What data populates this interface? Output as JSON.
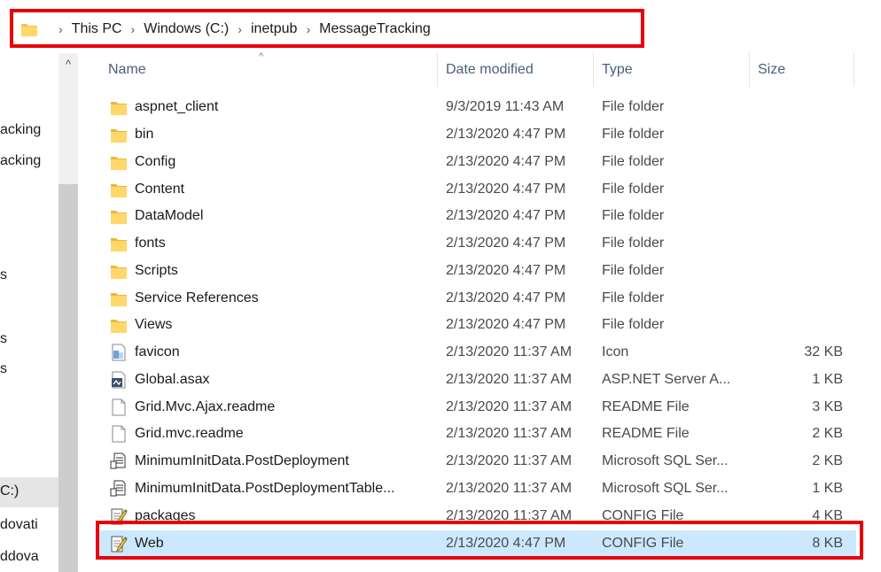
{
  "breadcrumb": {
    "items": [
      "This PC",
      "Windows (C:)",
      "inetpub",
      "MessageTracking"
    ],
    "separator": "›"
  },
  "nav": {
    "scroll_up": "^",
    "items": [
      {
        "label": "acking",
        "selected": false
      },
      {
        "label": "acking",
        "selected": false
      },
      {
        "label": "s",
        "selected": false
      },
      {
        "label": "s",
        "selected": false
      },
      {
        "label": "s",
        "selected": false
      },
      {
        "label": "C:)",
        "selected": true
      },
      {
        "label": "dovati",
        "selected": false
      },
      {
        "label": "ddova",
        "selected": false
      }
    ]
  },
  "columns": {
    "name": "Name",
    "date": "Date modified",
    "type": "Type",
    "size": "Size",
    "sort_indicator": "^"
  },
  "files": [
    {
      "name": "aspnet_client",
      "date": "9/3/2019 11:43 AM",
      "type": "File folder",
      "size": "",
      "icon": "folder-icon"
    },
    {
      "name": "bin",
      "date": "2/13/2020 4:47 PM",
      "type": "File folder",
      "size": "",
      "icon": "folder-icon"
    },
    {
      "name": "Config",
      "date": "2/13/2020 4:47 PM",
      "type": "File folder",
      "size": "",
      "icon": "folder-icon"
    },
    {
      "name": "Content",
      "date": "2/13/2020 4:47 PM",
      "type": "File folder",
      "size": "",
      "icon": "folder-icon"
    },
    {
      "name": "DataModel",
      "date": "2/13/2020 4:47 PM",
      "type": "File folder",
      "size": "",
      "icon": "folder-icon"
    },
    {
      "name": "fonts",
      "date": "2/13/2020 4:47 PM",
      "type": "File folder",
      "size": "",
      "icon": "folder-icon"
    },
    {
      "name": "Scripts",
      "date": "2/13/2020 4:47 PM",
      "type": "File folder",
      "size": "",
      "icon": "folder-icon"
    },
    {
      "name": "Service References",
      "date": "2/13/2020 4:47 PM",
      "type": "File folder",
      "size": "",
      "icon": "folder-icon"
    },
    {
      "name": "Views",
      "date": "2/13/2020 4:47 PM",
      "type": "File folder",
      "size": "",
      "icon": "folder-icon"
    },
    {
      "name": "favicon",
      "date": "2/13/2020 11:37 AM",
      "type": "Icon",
      "size": "32 KB",
      "icon": "image-file-icon"
    },
    {
      "name": "Global.asax",
      "date": "2/13/2020 11:37 AM",
      "type": "ASP.NET Server A...",
      "size": "1 KB",
      "icon": "asax-file-icon"
    },
    {
      "name": "Grid.Mvc.Ajax.readme",
      "date": "2/13/2020 11:37 AM",
      "type": "README File",
      "size": "3 KB",
      "icon": "blank-file-icon"
    },
    {
      "name": "Grid.mvc.readme",
      "date": "2/13/2020 11:37 AM",
      "type": "README File",
      "size": "2 KB",
      "icon": "blank-file-icon"
    },
    {
      "name": "MinimumInitData.PostDeployment",
      "date": "2/13/2020 11:37 AM",
      "type": "Microsoft SQL Ser...",
      "size": "2 KB",
      "icon": "sql-file-icon"
    },
    {
      "name": "MinimumInitData.PostDeploymentTable...",
      "date": "2/13/2020 11:37 AM",
      "type": "Microsoft SQL Ser...",
      "size": "1 KB",
      "icon": "sql-file-icon"
    },
    {
      "name": "packages",
      "date": "2/13/2020 11:37 AM",
      "type": "CONFIG File",
      "size": "4 KB",
      "icon": "config-file-icon"
    },
    {
      "name": "Web",
      "date": "2/13/2020 4:47 PM",
      "type": "CONFIG File",
      "size": "8 KB",
      "icon": "config-file-icon",
      "selected": true
    }
  ],
  "colors": {
    "highlight": "#e8000b",
    "selection": "#cce8ff",
    "folder": "#f3c547"
  }
}
